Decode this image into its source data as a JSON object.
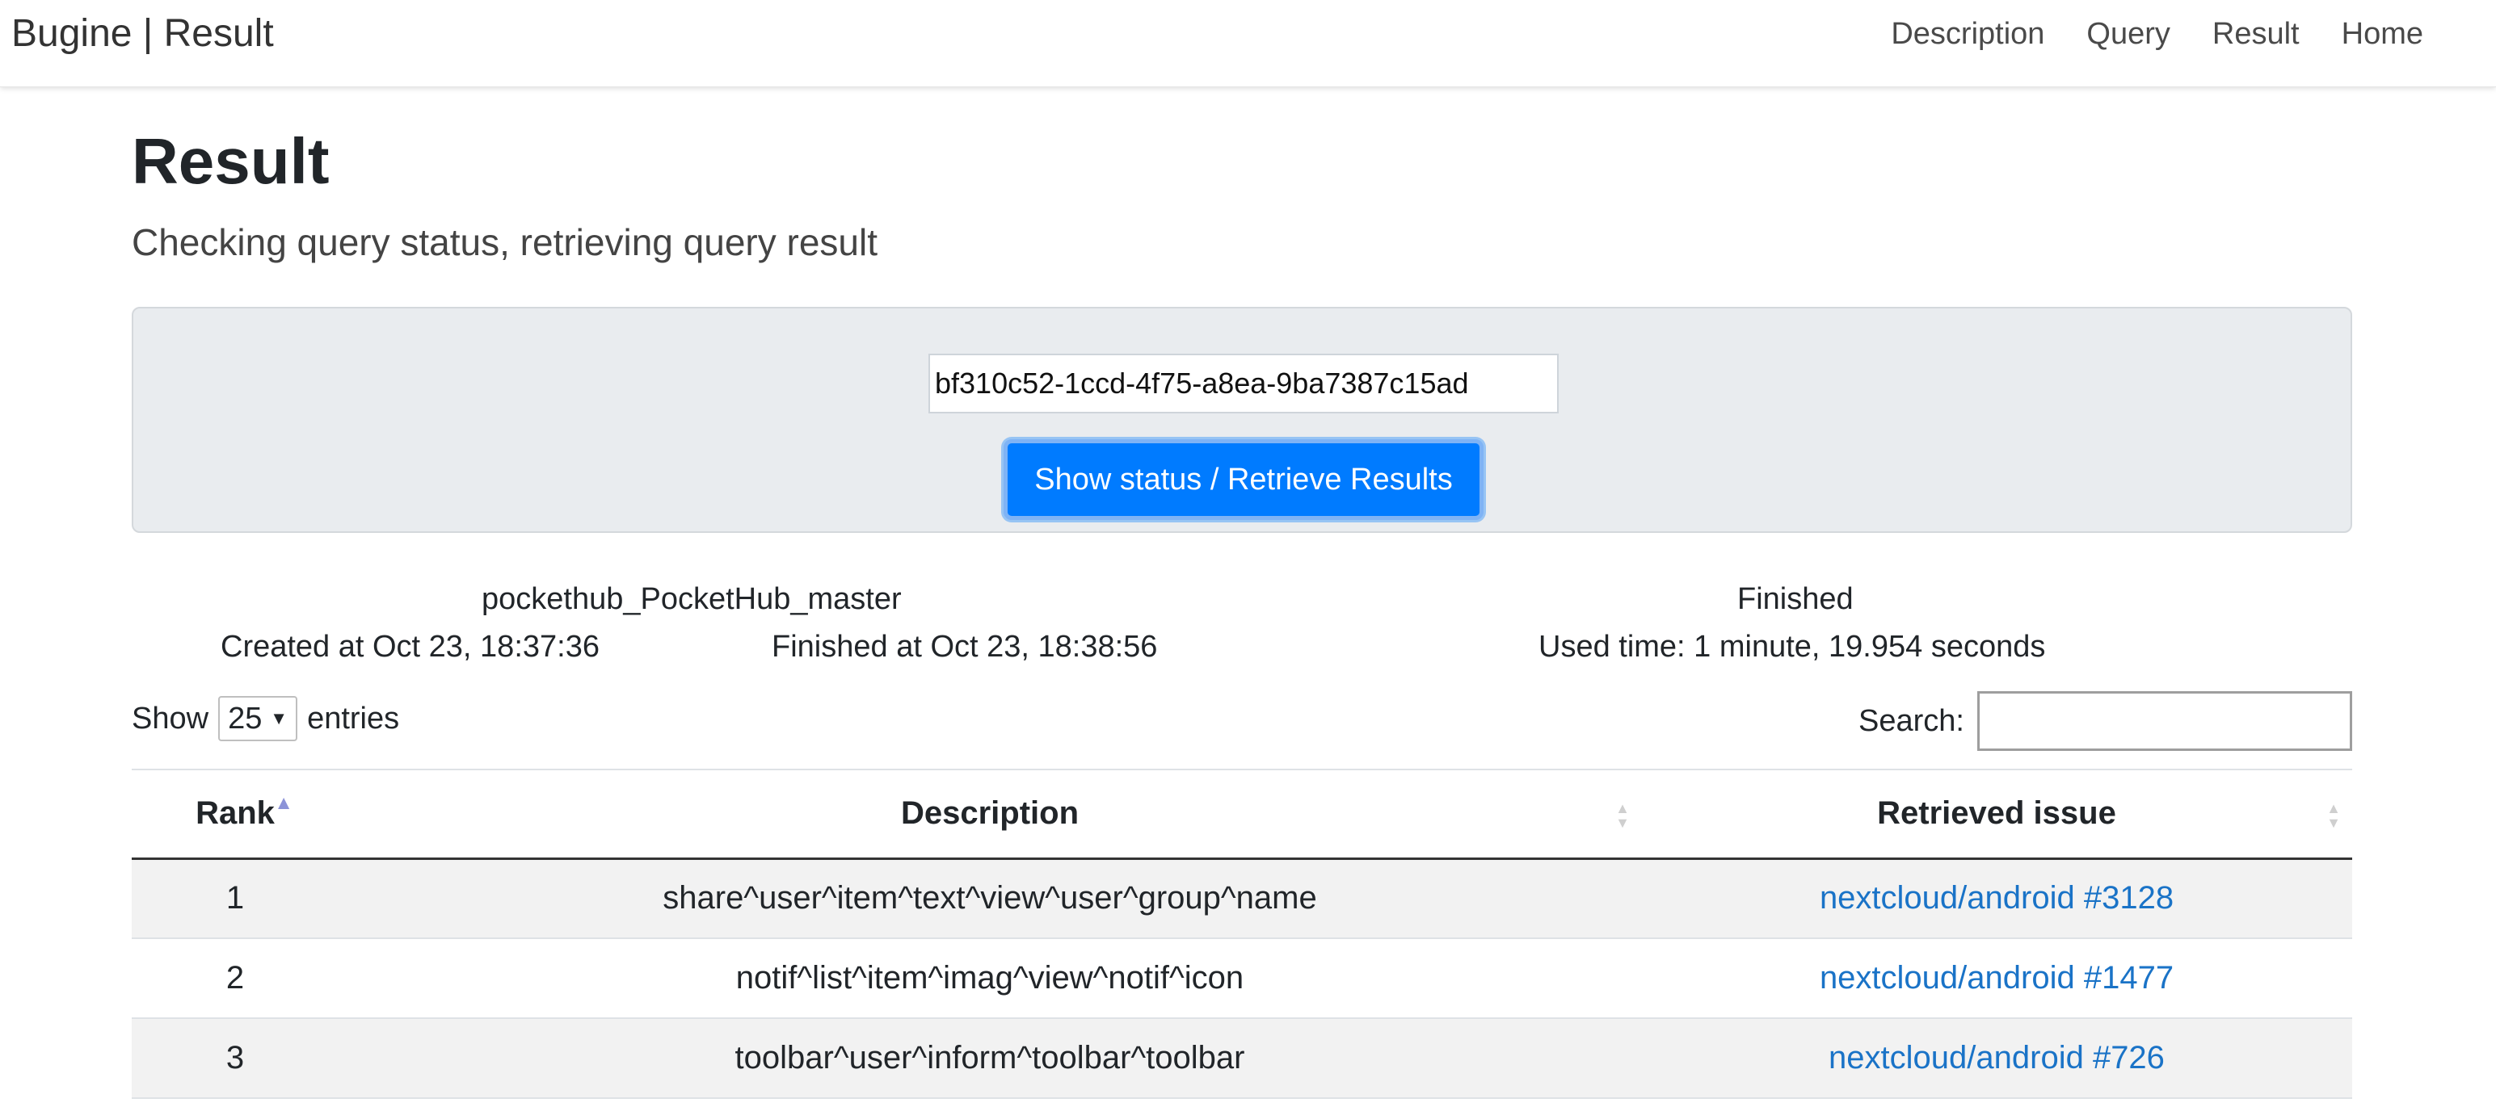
{
  "navbar": {
    "brand": "Bugine | Result",
    "links": [
      "Description",
      "Query",
      "Result",
      "Home"
    ]
  },
  "page": {
    "title": "Result",
    "subtitle": "Checking query status, retrieving query result"
  },
  "query": {
    "id_value": "bf310c52-1ccd-4f75-a8ea-9ba7387c15ad",
    "button_label": "Show status / Retrieve Results"
  },
  "meta": {
    "project": "pockethub_PocketHub_master",
    "created": "Created at Oct 23, 18:37:36",
    "finished_at": "Finished at Oct 23, 18:38:56",
    "status": "Finished",
    "used_time": "Used time: 1 minute, 19.954 seconds"
  },
  "controls": {
    "show_label": "Show",
    "entries_value": "25",
    "entries_label": "entries",
    "search_label": "Search:"
  },
  "table": {
    "headers": [
      "Rank",
      "Description",
      "Retrieved issue"
    ],
    "rows": [
      {
        "rank": "1",
        "description": "share^user^item^text^view^user^group^name",
        "issue": "nextcloud/android #3128"
      },
      {
        "rank": "2",
        "description": "notif^list^item^imag^view^notif^icon",
        "issue": "nextcloud/android #1477"
      },
      {
        "rank": "3",
        "description": "toolbar^user^inform^toolbar^toolbar",
        "issue": "nextcloud/android #726"
      }
    ]
  },
  "colors": {
    "primary": "#007bff",
    "link": "#1a73c7",
    "jumbotron": "#e9ecef"
  }
}
